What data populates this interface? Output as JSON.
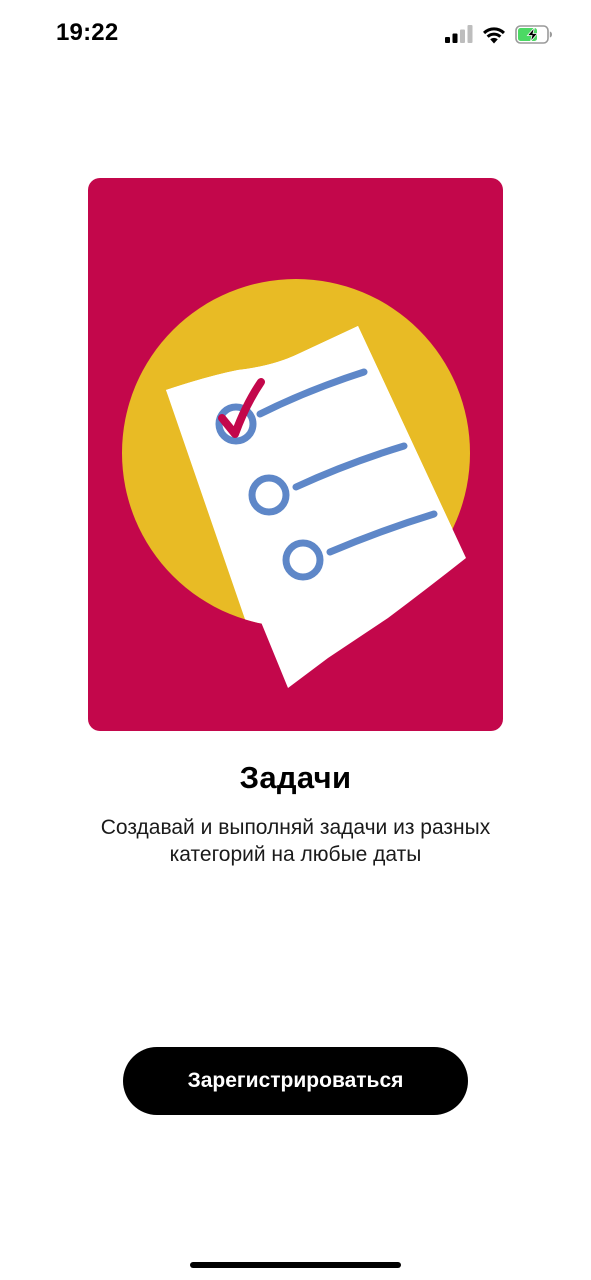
{
  "status_bar": {
    "time": "19:22",
    "icons": [
      "signal-icon",
      "wifi-icon",
      "battery-charging-icon"
    ],
    "battery_color": "#4cd964"
  },
  "illustration": {
    "icon": "checklist-icon",
    "colors": {
      "background": "#c3074b",
      "circle": "#e8bb25",
      "paper": "#ffffff",
      "lines": "#5e87c8",
      "check": "#c3074b"
    }
  },
  "onboarding": {
    "title": "Задачи",
    "description": "Создавай и выполняй задачи из разных категорий на любые даты"
  },
  "actions": {
    "register_label": "Зарегистрироваться"
  }
}
